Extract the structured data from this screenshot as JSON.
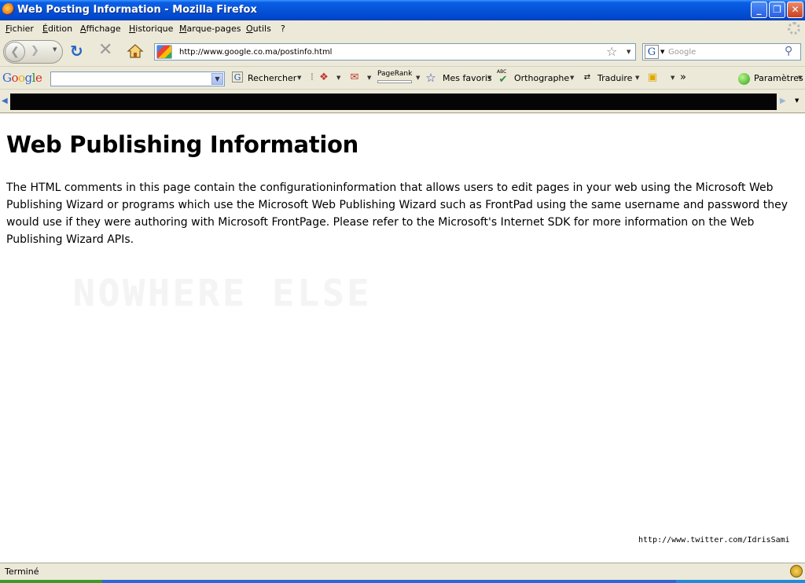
{
  "window": {
    "title": "Web Posting Information - Mozilla Firefox",
    "controls": {
      "minimize": "_",
      "maximize": "❐",
      "close": "✕"
    }
  },
  "menubar": {
    "items": [
      "Fichier",
      "Édition",
      "Affichage",
      "Historique",
      "Marque-pages",
      "Outils",
      "?"
    ]
  },
  "navbar": {
    "url": "http://www.google.co.ma/postinfo.html",
    "search_placeholder": "Google",
    "search_engine_letter": "G"
  },
  "google_toolbar": {
    "logo": [
      "G",
      "o",
      "o",
      "g",
      "l",
      "e"
    ],
    "search_value": "",
    "rechercher": "Rechercher",
    "pagerank": "PageRank",
    "mes_favoris": "Mes favoris",
    "orthographe": "Orthographe",
    "abc": "ABC",
    "traduire": "Traduire",
    "overflow": "»",
    "parametres": "Paramètres"
  },
  "content": {
    "heading": "Web Publishing Information",
    "body": "The HTML comments in this page contain the configurationinformation that allows users to edit pages in your web using the Microsoft Web Publishing Wizard or programs which use the Microsoft Web Publishing Wizard such as FrontPad using the same username and password they would use if they were authoring with Microsoft FrontPage. Please refer to the Microsoft's Internet SDK for more information on the Web Publishing Wizard APIs.",
    "watermark": "NOWHERE ELSE",
    "twitter": "http://www.twitter.com/IdrisSami"
  },
  "statusbar": {
    "text": "Terminé"
  },
  "colors": {
    "titlebar": "#0553d8",
    "chrome": "#ece9d8",
    "bookmark_strip": "#050505"
  }
}
